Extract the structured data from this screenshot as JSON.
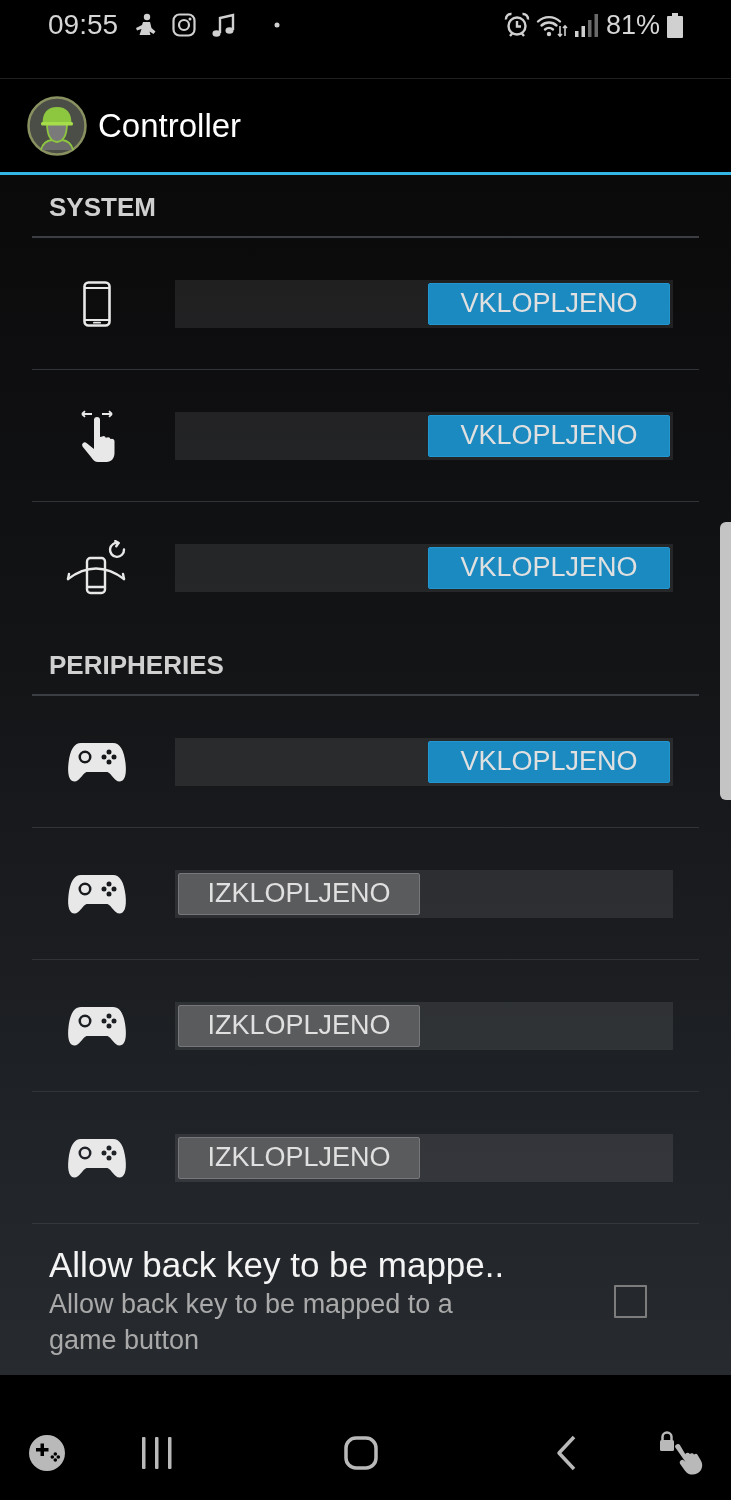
{
  "status_bar": {
    "time": "09:55",
    "battery_percent": "81%"
  },
  "action_bar": {
    "title": "Controller"
  },
  "sections": [
    {
      "title": "SYSTEM",
      "items": [
        {
          "kind": "toggle",
          "on": true,
          "label": "VKLOPLJENO"
        },
        {
          "kind": "toggle",
          "on": true,
          "label": "VKLOPLJENO"
        },
        {
          "kind": "toggle",
          "on": true,
          "label": "VKLOPLJENO"
        }
      ]
    },
    {
      "title": "PERIPHERIES",
      "items": [
        {
          "kind": "toggle",
          "on": true,
          "label": "VKLOPLJENO"
        },
        {
          "kind": "toggle",
          "on": false,
          "label": "IZKLOPLJENO"
        },
        {
          "kind": "toggle",
          "on": false,
          "label": "IZKLOPLJENO"
        },
        {
          "kind": "toggle",
          "on": false,
          "label": "IZKLOPLJENO"
        },
        {
          "kind": "checkbox",
          "title": "Allow back key to be mappe..",
          "summary": "Allow back key to be mapped to a game button",
          "checked": false
        }
      ]
    }
  ]
}
